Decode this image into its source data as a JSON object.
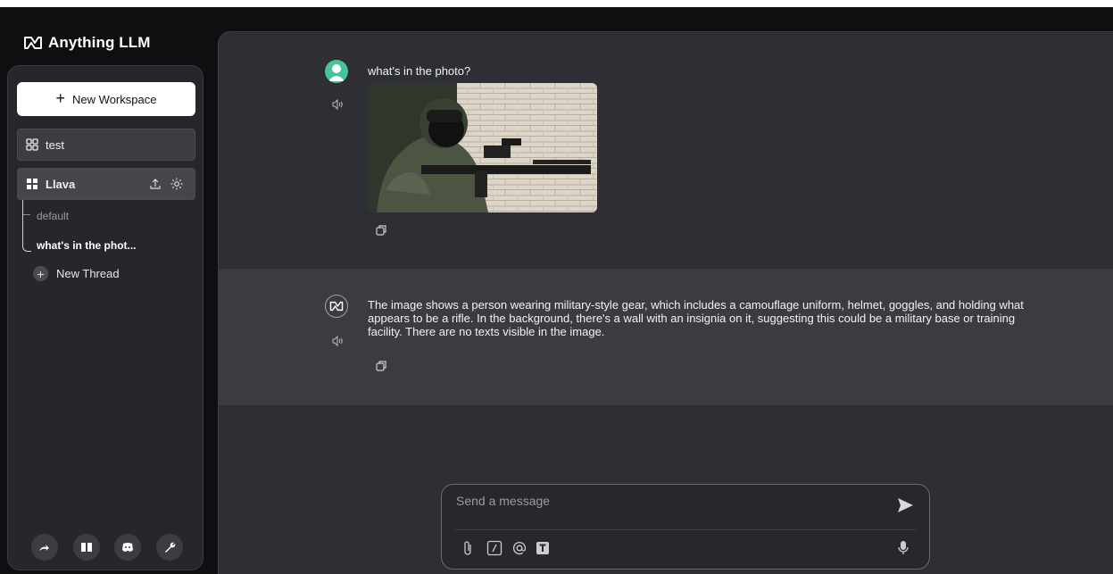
{
  "app": {
    "name": "Anything LLM"
  },
  "sidebar": {
    "new_workspace_label": "New Workspace",
    "workspaces": [
      {
        "label": "test"
      },
      {
        "label": "Llava"
      }
    ],
    "threads": [
      {
        "label": "default"
      },
      {
        "label": "what's in the phot..."
      }
    ],
    "new_thread_label": "New Thread",
    "footer_icons": [
      "community-icon",
      "docs-book-icon",
      "discord-icon",
      "settings-wrench-icon"
    ]
  },
  "chat": {
    "messages": [
      {
        "role": "user",
        "text": "what's in the photo?",
        "attachment": "photo"
      },
      {
        "role": "assistant",
        "text": "The image shows a person wearing military-style gear, which includes a camouflage uniform, helmet, goggles, and holding what appears to be a rifle. In the background, there's a wall with an insignia on it, suggesting this could be a military base or training facility. There are no texts visible in the image."
      }
    ]
  },
  "composer": {
    "placeholder": "Send a message",
    "tools": [
      "attach-icon",
      "slash-command-icon",
      "mention-icon",
      "text-size-icon"
    ]
  },
  "colors": {
    "background": "#0e0f11",
    "sidebar": "#25272c",
    "main_panel": "#2e2f34",
    "assistant_row": "#3a3c42",
    "user_avatar": "#46c49a",
    "new_workspace_button": "#ffffff"
  }
}
